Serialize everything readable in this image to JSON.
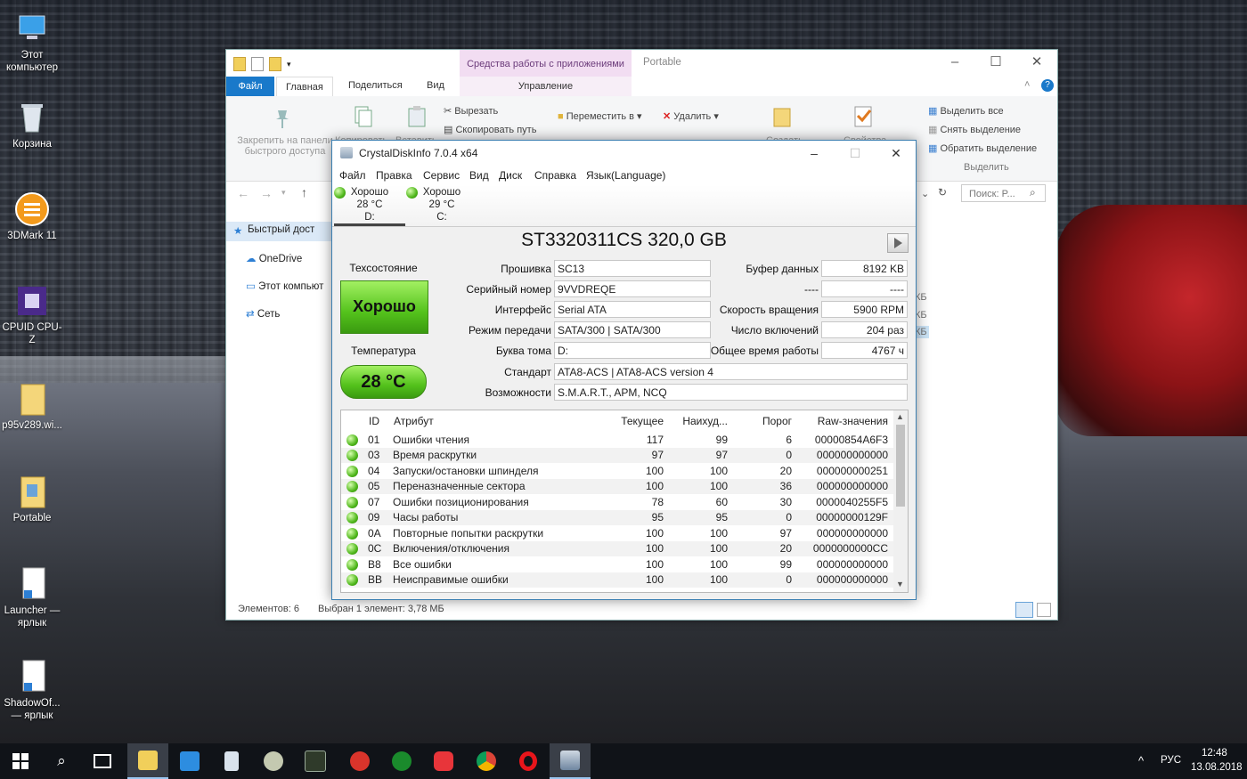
{
  "desktop": {
    "icons": [
      {
        "label": "Этот компьютер"
      },
      {
        "label": "Корзина"
      },
      {
        "label": "3DMark 11"
      },
      {
        "label": "CPUID CPU-Z"
      },
      {
        "label": "p95v289.wi..."
      },
      {
        "label": "Portable"
      },
      {
        "label": "Launcher — ярлык"
      },
      {
        "label": "ShadowOf... — ярлык"
      }
    ]
  },
  "explorer": {
    "title": "Portable",
    "context_group": "Средства работы с приложениями",
    "tabs": [
      "Файл",
      "Главная",
      "Поделиться",
      "Вид",
      "Управление"
    ],
    "ribbon": {
      "pin": "Закрепить на панели быстрого доступа",
      "copy": "Копировать",
      "paste": "Вставить",
      "cut": "Вырезать",
      "copy_path": "Скопировать путь",
      "move_to": "Переместить в",
      "delete": "Удалить",
      "new": "Создать",
      "properties": "Свойства",
      "select_all": "Выделить все",
      "select_none": "Снять выделение",
      "invert": "Обратить выделение",
      "select_group": "Выделить"
    },
    "search_placeholder": "Поиск: P...",
    "nav": [
      "Быстрый дост",
      "OneDrive",
      "Этот компьют",
      "Сеть"
    ],
    "status_count": "Элементов: 6",
    "status_selected": "Выбран 1 элемент: 3,78 МБ",
    "size_col": [
      "КБ",
      "КБ",
      "КБ"
    ]
  },
  "cdi": {
    "title": "CrystalDiskInfo 7.0.4 x64",
    "menu": [
      "Файл",
      "Правка",
      "Сервис",
      "Вид",
      "Диск",
      "Справка",
      "Язык(Language)"
    ],
    "disks": [
      {
        "status": "Хорошо",
        "temp": "28 °C",
        "letter": "D:"
      },
      {
        "status": "Хорошо",
        "temp": "29 °C",
        "letter": "C:"
      }
    ],
    "model": "ST3320311CS 320,0 GB",
    "health_label": "Техсостояние",
    "health_value": "Хорошо",
    "temp_label": "Температура",
    "temp_value": "28 °C",
    "left_fields": [
      {
        "label": "Прошивка",
        "value": "SC13"
      },
      {
        "label": "Серийный номер",
        "value": "9VVDREQE"
      },
      {
        "label": "Интерфейс",
        "value": "Serial ATA"
      },
      {
        "label": "Режим передачи",
        "value": "SATA/300 | SATA/300"
      },
      {
        "label": "Буква тома",
        "value": "D:"
      }
    ],
    "right_fields": [
      {
        "label": "Буфер данных",
        "value": "8192 KB"
      },
      {
        "label": "----",
        "value": "----"
      },
      {
        "label": "Скорость вращения",
        "value": "5900 RPM"
      },
      {
        "label": "Число включений",
        "value": "204 раз"
      },
      {
        "label": "Общее время работы",
        "value": "4767 ч"
      }
    ],
    "standard_label": "Стандарт",
    "standard_value": "ATA8-ACS | ATA8-ACS version 4",
    "features_label": "Возможности",
    "features_value": "S.M.A.R.T., APM, NCQ",
    "smart_headers": [
      "ID",
      "Атрибут",
      "Текущее",
      "Наихуд...",
      "Порог",
      "Raw-значения"
    ],
    "smart_rows": [
      [
        "01",
        "Ошибки чтения",
        "117",
        "99",
        "6",
        "00000854A6F3"
      ],
      [
        "03",
        "Время раскрутки",
        "97",
        "97",
        "0",
        "000000000000"
      ],
      [
        "04",
        "Запуски/остановки шпинделя",
        "100",
        "100",
        "20",
        "000000000251"
      ],
      [
        "05",
        "Переназначенные сектора",
        "100",
        "100",
        "36",
        "000000000000"
      ],
      [
        "07",
        "Ошибки позиционирования",
        "78",
        "60",
        "30",
        "0000040255F5"
      ],
      [
        "09",
        "Часы работы",
        "95",
        "95",
        "0",
        "00000000129F"
      ],
      [
        "0A",
        "Повторные попытки раскрутки",
        "100",
        "100",
        "97",
        "000000000000"
      ],
      [
        "0C",
        "Включения/отключения",
        "100",
        "100",
        "20",
        "0000000000CC"
      ],
      [
        "B8",
        "Все ошибки",
        "100",
        "100",
        "99",
        "000000000000"
      ],
      [
        "BB",
        "Неисправимые ошибки",
        "100",
        "100",
        "0",
        "000000000000"
      ]
    ]
  },
  "taskbar": {
    "lang": "РУС",
    "time": "12:48",
    "date": "13.08.2018"
  }
}
